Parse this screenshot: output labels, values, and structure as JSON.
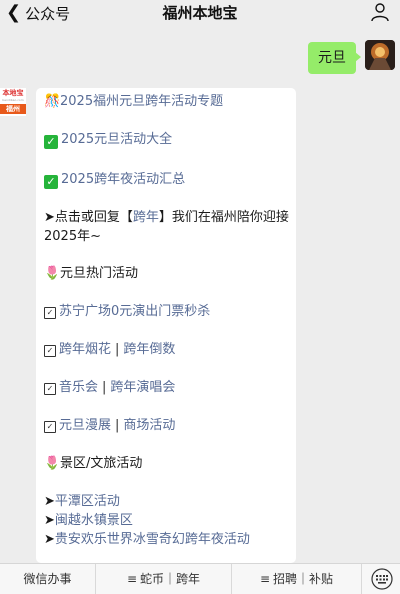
{
  "header": {
    "back_label": "公众号",
    "title": "福州本地宝"
  },
  "user_message": "元旦",
  "bot_avatar": {
    "logo_top": "本地宝",
    "logo_mid": "bendibao.com",
    "logo_bottom": "福州"
  },
  "article": {
    "line1": {
      "icon": "🎊",
      "text": "2025福州元旦跨年活动专题"
    },
    "line2": {
      "text": "2025元旦活动大全"
    },
    "line3": {
      "text": "2025跨年夜活动汇总"
    },
    "reply": {
      "prefix": "➤点击或回复【",
      "keyword": "跨年",
      "suffix": "】我们在福州陪你迎接2025年~"
    },
    "section1": {
      "icon": "🌷",
      "title": "元旦热门活动"
    },
    "row1": {
      "a": "苏宁广场0元演出门票秒杀"
    },
    "row2": {
      "a": "跨年烟花",
      "sep": "|",
      "b": "跨年倒数"
    },
    "row3": {
      "a": "音乐会",
      "sep": "|",
      "b": "跨年演唱会"
    },
    "row4": {
      "a": "元旦漫展",
      "sep": "|",
      "b": "商场活动"
    },
    "section2": {
      "icon": "🌷",
      "title": "景区/文旅活动"
    },
    "arrow_prefix": "➤",
    "scenic1": "平潭区活动",
    "scenic2": "闽越水镇景区",
    "scenic3": "贵安欢乐世界冰雪奇幻跨年夜活动"
  },
  "bottom_menu": {
    "item1": "微信办事",
    "item2": "蛇币｜跨年",
    "item3": "招聘｜补贴"
  }
}
